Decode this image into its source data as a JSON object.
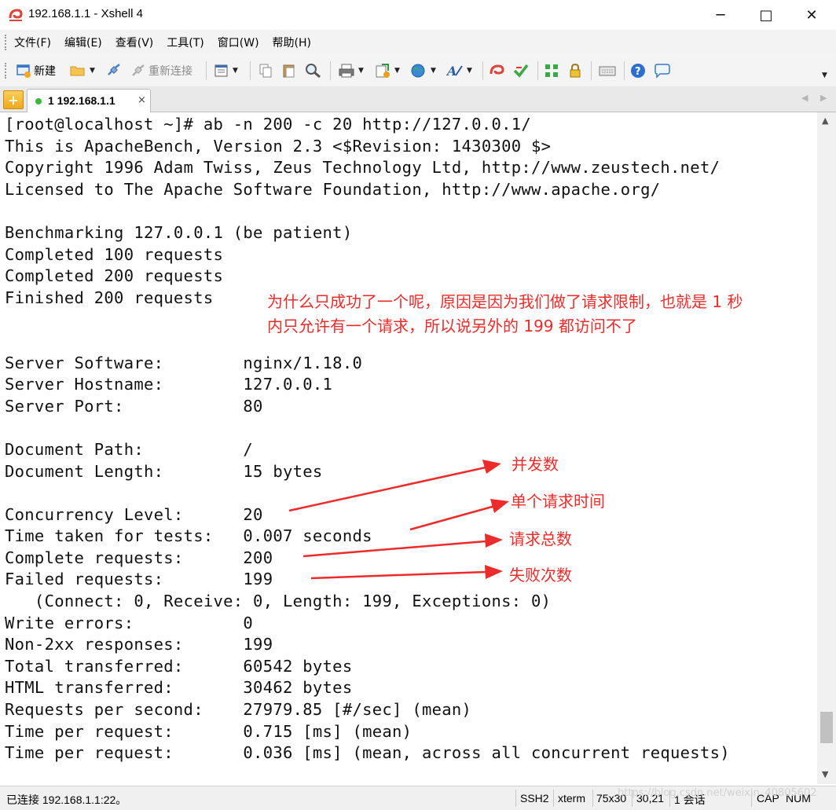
{
  "window": {
    "title": "192.168.1.1 - Xshell 4",
    "minimize_glyph": "─",
    "maximize_glyph": "□",
    "close_glyph": "✕"
  },
  "menu": [
    "文件(F)",
    "编辑(E)",
    "查看(V)",
    "工具(T)",
    "窗口(W)",
    "帮助(H)"
  ],
  "toolbar": {
    "new_label": "新建",
    "reconnect_label": "重新连接"
  },
  "tabs": {
    "active": {
      "label": "1 192.168.1.1",
      "close": "×"
    }
  },
  "terminal": {
    "lines": [
      "[root@localhost ~]# ab -n 200 -c 20 http://127.0.0.1/",
      "This is ApacheBench, Version 2.3 <$Revision: 1430300 $>",
      "Copyright 1996 Adam Twiss, Zeus Technology Ltd, http://www.zeustech.net/",
      "Licensed to The Apache Software Foundation, http://www.apache.org/",
      "",
      "Benchmarking 127.0.0.1 (be patient)",
      "Completed 100 requests",
      "Completed 200 requests",
      "Finished 200 requests",
      "",
      "",
      "Server Software:        nginx/1.18.0",
      "Server Hostname:        127.0.0.1",
      "Server Port:            80",
      "",
      "Document Path:          /",
      "Document Length:        15 bytes",
      "",
      "Concurrency Level:      20",
      "Time taken for tests:   0.007 seconds",
      "Complete requests:      200",
      "Failed requests:        199",
      "   (Connect: 0, Receive: 0, Length: 199, Exceptions: 0)",
      "Write errors:           0",
      "Non-2xx responses:      199",
      "Total transferred:      60542 bytes",
      "HTML transferred:       30462 bytes",
      "Requests per second:    27979.85 [#/sec] (mean)",
      "Time per request:       0.715 [ms] (mean)",
      "Time per request:       0.036 [ms] (mean, across all concurrent requests)"
    ]
  },
  "annotations": {
    "note_line1": "为什么只成功了一个呢，原因是因为我们做了请求限制，也就是 1 秒",
    "note_line2": "内只允许有一个请求，所以说另外的 199 都访问不了",
    "concurrency": "并发数",
    "time_per_request": "单个请求时间",
    "total_requests": "请求总数",
    "failed_count": "失败次数",
    "color": "#ee2b2b"
  },
  "statusbar": {
    "connection": "已连接 192.168.1.1:22。",
    "protocol": "SSH2",
    "terminal_type": "xterm",
    "size": "75x30",
    "cursor": "30,21",
    "sessions": "1 会话",
    "caps": "CAP",
    "num": "NUM",
    "watermark": "https://blog.csdn.net/weixin_40805602"
  }
}
